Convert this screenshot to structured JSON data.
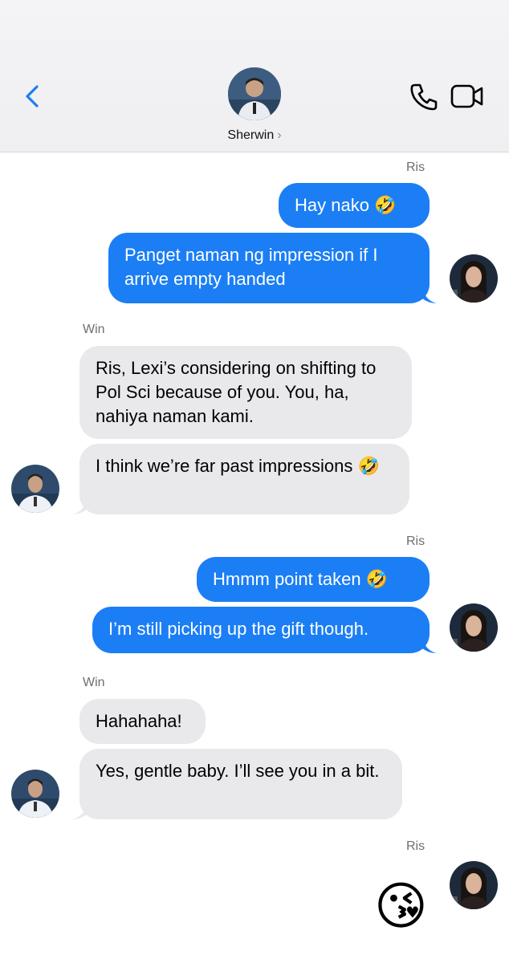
{
  "header": {
    "contact_name": "Sherwin",
    "chevron": "›",
    "icons": {
      "back": "chevron-left-icon",
      "call": "phone-icon",
      "video": "video-camera-icon"
    },
    "accent_color": "#1b7ef5"
  },
  "messages": [
    {
      "sender": "Ris",
      "direction": "outgoing",
      "texts": [
        "Hay nako 🤣",
        "Panget naman ng impression if I arrive empty handed"
      ]
    },
    {
      "sender": "Win",
      "direction": "incoming",
      "texts": [
        "Ris, Lexi’s considering on shifting to Pol Sci because of you. You, ha, nahiya naman kami.",
        "I think we’re far past impressions 🤣"
      ]
    },
    {
      "sender": "Ris",
      "direction": "outgoing",
      "texts": [
        "Hmmm point taken 🤣",
        "I’m still picking up the gift though."
      ]
    },
    {
      "sender": "Win",
      "direction": "incoming",
      "texts": [
        "Hahahaha!",
        "Yes, gentle baby. I’ll see you in a bit."
      ]
    },
    {
      "sender": "Ris",
      "direction": "outgoing",
      "texts": [
        "😘"
      ]
    }
  ]
}
